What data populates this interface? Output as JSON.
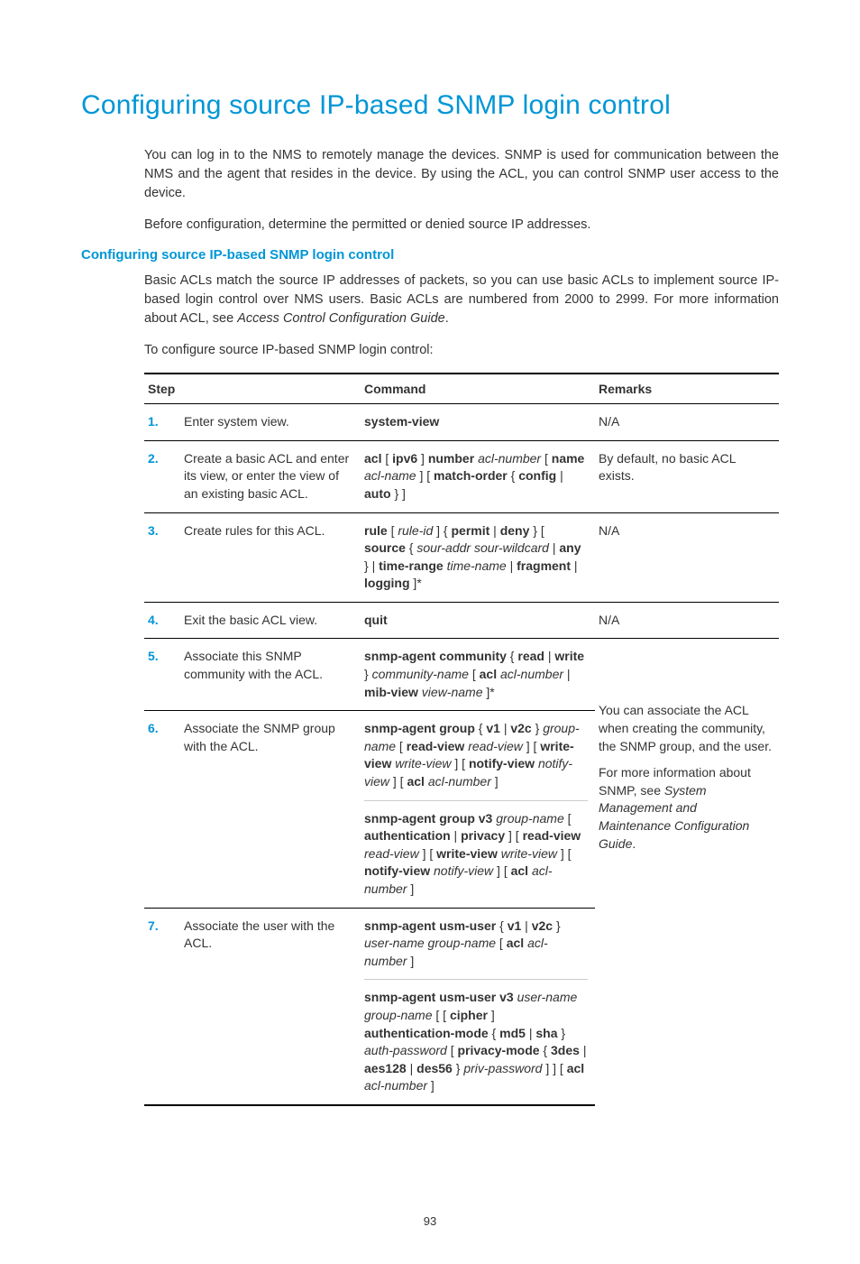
{
  "title": "Configuring source IP-based SNMP login control",
  "intro1": "You can log in to the NMS to remotely manage the devices. SNMP is used for communication between the NMS and the agent that resides in the device. By using the ACL, you can control SNMP user access to the device.",
  "intro2": "Before configuration, determine the permitted or denied source IP addresses.",
  "h3": "Configuring source IP-based SNMP login control",
  "desc_pre": "Basic ACLs match the source IP addresses of packets, so you can use basic ACLs to implement source IP-based login control over NMS users. Basic ACLs are numbered from 2000 to 2999. For more information about ACL, see ",
  "desc_em": "Access Control Configuration Guide",
  "desc_post": ".",
  "lead": "To configure source IP-based SNMP login control:",
  "th_step": "Step",
  "th_cmd": "Command",
  "th_rem": "Remarks",
  "r1_n": "1.",
  "r1_s": "Enter system view.",
  "r1_c": "system-view",
  "r1_r": "N/A",
  "r2_n": "2.",
  "r2_s": "Create a basic ACL and enter its view, or enter the view of an existing basic ACL.",
  "r2_r": "By default, no basic ACL exists.",
  "r3_n": "3.",
  "r3_s": "Create rules for this ACL.",
  "r3_r": "N/A",
  "r4_n": "4.",
  "r4_s": "Exit the basic ACL view.",
  "r4_c": "quit",
  "r4_r": "N/A",
  "r5_n": "5.",
  "r5_s": "Associate this SNMP community with the ACL.",
  "r6_n": "6.",
  "r6_s": "Associate the SNMP group with the ACL.",
  "r7_n": "7.",
  "r7_s": "Associate the user with the ACL.",
  "rem_p1": "You can associate the ACL when creating the community, the SNMP group, and the user.",
  "rem_p2a": "For more information about SNMP, see ",
  "rem_p2b": "System Management and Maintenance Configuration Guide",
  "rem_p2c": ".",
  "page": "93"
}
